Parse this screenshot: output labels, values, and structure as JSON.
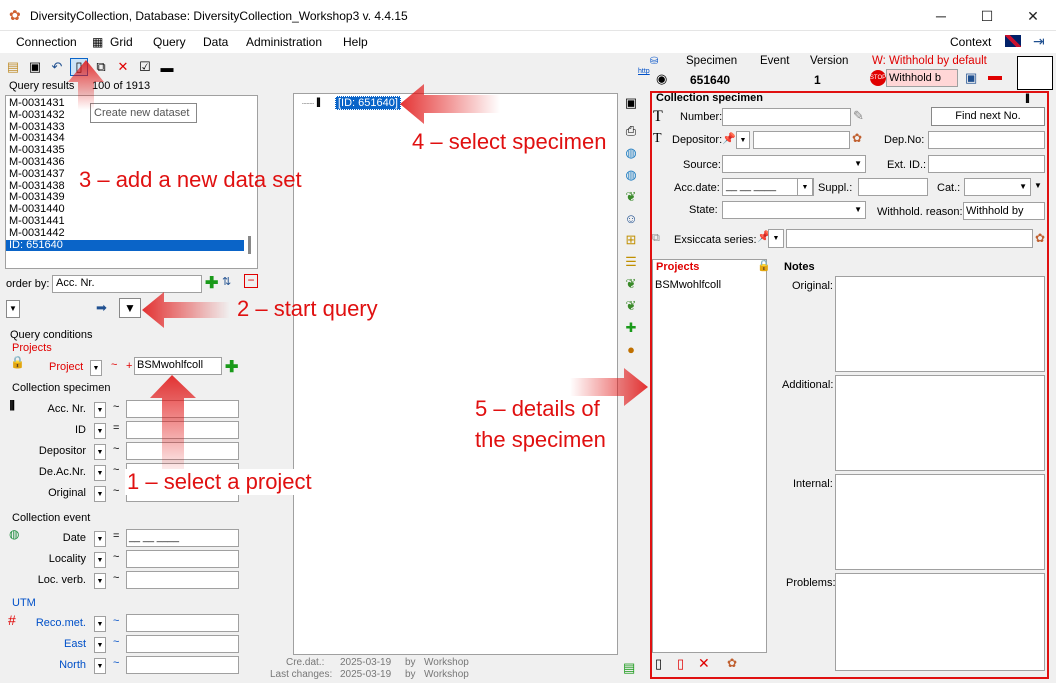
{
  "window": {
    "title": "DiversityCollection,  Database: DiversityCollection_Workshop3    v. 4.4.15",
    "min": "─",
    "max": "☐",
    "close": "✕"
  },
  "menu": {
    "items": [
      "Connection",
      "Grid",
      "Query",
      "Data",
      "Administration",
      "Help"
    ],
    "context": "Context"
  },
  "header": {
    "specimen_label": "Specimen",
    "specimen_value": "651640",
    "event_label": "Event",
    "version_label": "Version",
    "version_value": "1",
    "withhold_label": "W: Withhold by default",
    "withhold_value": "Withhold b"
  },
  "query": {
    "results_label": "Query results",
    "results_count": "100 of 1913",
    "tooltip": "Create new dataset",
    "results": [
      "M-0031431",
      "M-0031432",
      "M-0031433",
      "M-0031434",
      "M-0031435",
      "M-0031436",
      "M-0031437",
      "M-0031438",
      "M-0031439",
      "M-0031440",
      "M-0031441",
      "M-0031442",
      "ID: 651640"
    ],
    "order_by_label": "order by:",
    "order_by_value": "Acc. Nr.",
    "conditions_label": "Query conditions",
    "projects_label": "Projects",
    "project_field": "Project",
    "project_value": "BSMwohlfcoll",
    "cs_label": "Collection specimen",
    "cs_fields": [
      "Acc. Nr.",
      "ID",
      "Depositor",
      "De.Ac.Nr.",
      "Original"
    ],
    "cs_ops": [
      "~",
      "=",
      "~",
      "~",
      "~"
    ],
    "ce_label": "Collection event",
    "ce_fields": [
      "Date",
      "Locality",
      "Loc. verb."
    ],
    "ce_ops": [
      "=",
      "~",
      "~"
    ],
    "date_placeholder": "__ __ ____",
    "utm_label": "UTM",
    "utm_fields": [
      "Reco.met.",
      "East",
      "North"
    ],
    "utm_ops": [
      "~",
      "~",
      "~"
    ]
  },
  "tree": {
    "node": "[ID: 651640]",
    "cre_label": "Cre.dat.:",
    "cre_date": "2025-03-19",
    "by": "by",
    "cre_user": "Workshop",
    "last_label": "Last changes:",
    "last_date": "2025-03-19",
    "last_user": "Workshop"
  },
  "details": {
    "section_title": "Collection specimen",
    "number_label": "Number:",
    "find_next": "Find next No.",
    "depositor_label": "Depositor:",
    "depno_label": "Dep.No:",
    "source_label": "Source:",
    "extid_label": "Ext. ID.:",
    "accdate_label": "Acc.date:",
    "suppl_label": "Suppl.:",
    "cat_label": "Cat.:",
    "state_label": "State:",
    "withhold_label": "Withhold. reason:",
    "withhold_value": "Withhold by",
    "exsiccata_label": "Exsiccata series:",
    "projects_title": "Projects",
    "project_item": "BSMwohlfcoll",
    "notes_title": "Notes",
    "notes": [
      "Original:",
      "Additional:",
      "Internal:",
      "Problems:"
    ]
  },
  "annotations": {
    "a1": "1 – select a project",
    "a2": "2 – start query",
    "a3": "3 – add a new data set",
    "a4": "4 – select specimen",
    "a5a": "5 – details of",
    "a5b": "the specimen"
  },
  "colors": {
    "annotation": "#e01010",
    "selection": "#0a64c8",
    "accent": "#e00000"
  }
}
